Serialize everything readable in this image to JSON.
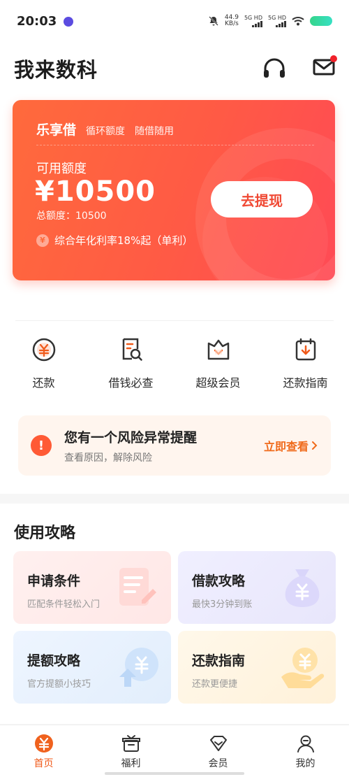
{
  "status_bar": {
    "time": "20:03",
    "net_speed_value": "44.9",
    "net_speed_unit": "KB/s",
    "sim1": "5G HD",
    "sim2": "5G HD"
  },
  "header": {
    "title": "我来数科",
    "icons": [
      "headset-icon",
      "mail-icon"
    ]
  },
  "loan_card": {
    "product": "乐享借",
    "tag1": "循环额度",
    "tag2": "随借随用",
    "available_label": "可用额度",
    "amount": "¥10500",
    "total": "总额度：10500",
    "rate_icon": "¥",
    "rate_text": "综合年化利率18%起（单利）",
    "withdraw_button": "去提现",
    "colors": {
      "start": "#ff6a3c",
      "end": "#ff4a55"
    }
  },
  "shortcuts": [
    {
      "label": "还款",
      "icon": "yuan-circle-icon"
    },
    {
      "label": "借钱必查",
      "icon": "document-search-icon"
    },
    {
      "label": "超级会员",
      "icon": "vip-box-icon"
    },
    {
      "label": "还款指南",
      "icon": "calendar-download-icon"
    }
  ],
  "alert": {
    "icon": "!",
    "title": "您有一个风险异常提醒",
    "subtitle": "查看原因，解除风险",
    "link": "立即查看"
  },
  "guide": {
    "title": "使用攻略",
    "cards": [
      {
        "title": "申请条件",
        "subtitle": "匹配条件轻松入门",
        "icon": "form-edit-icon"
      },
      {
        "title": "借款攻略",
        "subtitle": "最快3分钟到账",
        "icon": "money-bag-icon"
      },
      {
        "title": "提额攻略",
        "subtitle": "官方提额小技巧",
        "icon": "yuan-up-icon"
      },
      {
        "title": "还款指南",
        "subtitle": "还款更便捷",
        "icon": "hand-coin-icon"
      }
    ]
  },
  "tabbar": {
    "tabs": [
      {
        "label": "首页",
        "icon": "home-yuan-icon",
        "active": true
      },
      {
        "label": "福利",
        "icon": "gift-icon",
        "active": false
      },
      {
        "label": "会员",
        "icon": "member-icon",
        "active": false
      },
      {
        "label": "我的",
        "icon": "profile-icon",
        "active": false
      }
    ],
    "accent": "#f05a1a"
  }
}
